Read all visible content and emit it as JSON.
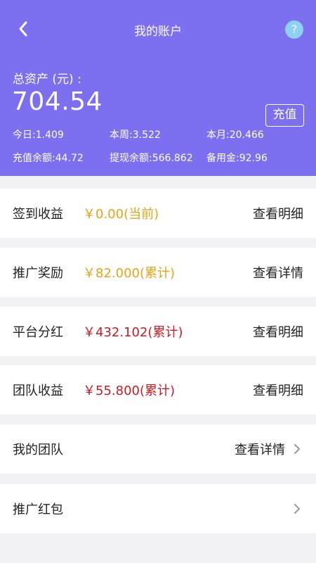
{
  "header": {
    "title": "我的账户",
    "back_icon": "chevron-left-icon",
    "help_label": "?",
    "total_label": "总资产 (元) :",
    "total_amount": "704.54",
    "recharge_label": "充值",
    "background_color": "#7c6ff0",
    "stats": {
      "today": "今日:1.409",
      "week": "本周:3.522",
      "month": "本月:20.466",
      "recharge_balance": "充值余额:44.72",
      "withdraw_balance": "提现余额:566.862",
      "reserve": "备用金:92.96"
    }
  },
  "rows": [
    {
      "label": "签到收益",
      "value": "￥0.00(当前)",
      "value_color": "#e2a418",
      "action": "查看明细"
    },
    {
      "label": "推广奖励",
      "value": "￥82.000(累计)",
      "value_color": "#e2a418",
      "action": "查看详情"
    },
    {
      "label": "平台分红",
      "value": "￥432.102(累计)",
      "value_color": "#c41e25",
      "action": "查看明细"
    },
    {
      "label": "团队收益",
      "value": "￥55.800(累计)",
      "value_color": "#c41e25",
      "action": "查看明细"
    },
    {
      "label": "我的团队",
      "action": "查看详情",
      "arrow_icon": "chevron-right-icon"
    },
    {
      "label": "推广红包",
      "arrow_icon": "chevron-right-icon"
    }
  ]
}
